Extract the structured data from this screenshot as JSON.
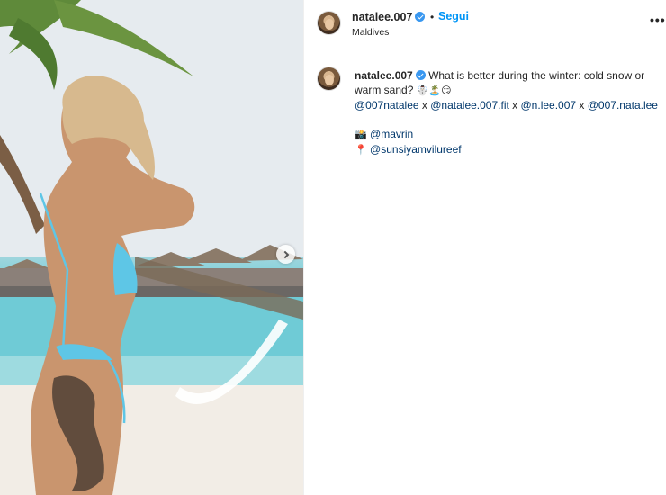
{
  "post": {
    "username": "natalee.007",
    "follow_label": "Segui",
    "separator": "•",
    "location": "Maldives",
    "more_label": "•••"
  },
  "caption": {
    "username": "natalee.007",
    "text": "What is better during the winter: cold snow or warm sand?",
    "emojis": "☃️🏝️😏",
    "mentions_line": [
      {
        "handle": "@007natalee",
        "sep": " x "
      },
      {
        "handle": "@natalee.007.fit",
        "sep": " x "
      },
      {
        "handle": "@n.lee.007",
        "sep": " x "
      },
      {
        "handle": "@007.nata.lee",
        "sep": ""
      }
    ],
    "camera_emoji": "📸",
    "photographer": "@mavrin",
    "pin_emoji": "📍",
    "place": "@sunsiyamvilureef"
  },
  "media": {
    "next_icon": "chevron-right-icon"
  },
  "colors": {
    "link": "#00376b",
    "follow": "#0095f6",
    "verified": "#3897f0"
  }
}
